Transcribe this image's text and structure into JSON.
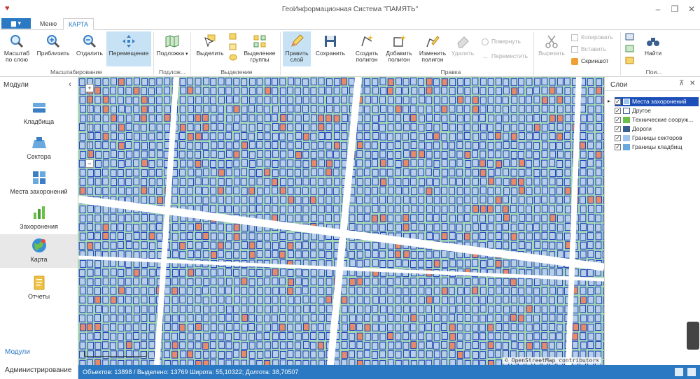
{
  "window": {
    "title": "ГеоИнформационная Система \"ПАМЯТЬ\"",
    "controls": [
      "–",
      "❐",
      "✕"
    ]
  },
  "tabs": {
    "app_button": "▆ ▾",
    "menu": "Меню",
    "map": "КАРТА"
  },
  "ribbon": {
    "fit_layer": "Масштаб\nпо слою",
    "zoom_in": "Приблизить",
    "zoom_out": "Отдалить",
    "pan": "Перемещение",
    "basemap": "Подложка",
    "select": "Выделить",
    "select_group": "Выделение\nгруппы",
    "edit_layer": "Править\nслой",
    "save": "Сохранить",
    "create_polygon": "Создать\nполигон",
    "add_polygon": "Добавить\nполигон",
    "modify_polygon": "Изменить\nполигон",
    "delete": "Удалить",
    "rotate": "Повернуть",
    "move": "Переместить",
    "cut": "Вырезать",
    "copy": "Копировать",
    "paste": "Вставить",
    "screenshot": "Скриншот",
    "find": "Найти",
    "groups": {
      "scale": "Масштабирование",
      "basemap": "Подлож...",
      "selection": "Выделение",
      "edit": "Правка",
      "search": "Пои..."
    }
  },
  "sidebar": {
    "header": "Модули",
    "items": [
      {
        "label": "Кладбища",
        "icon": "cemetery-icon"
      },
      {
        "label": "Сектора",
        "icon": "sectors-icon"
      },
      {
        "label": "Места захоронений",
        "icon": "burial-places-icon"
      },
      {
        "label": "Захоронения",
        "icon": "burials-icon"
      },
      {
        "label": "Карта",
        "icon": "globe-icon"
      },
      {
        "label": "Отчеты",
        "icon": "reports-icon"
      }
    ],
    "footer_modules": "Модули",
    "footer_admin": "Администрирование"
  },
  "map": {
    "attribution": "© OpenStreetMap contributors"
  },
  "layers_panel": {
    "title": "Слои",
    "pin": "⊼",
    "close": "✕",
    "layers": [
      {
        "name": "Места захоронений",
        "checked": true
      },
      {
        "name": "Другое",
        "checked": true
      },
      {
        "name": "Технические сооруж...",
        "checked": true
      },
      {
        "name": "Дороги",
        "checked": true
      },
      {
        "name": "Границы секторов",
        "checked": true
      },
      {
        "name": "Границы кладбищ",
        "checked": true
      }
    ]
  },
  "status": {
    "text": "Объектов: 13898 / Выделено: 13769   Широта: 55,10322; Долгота: 38,70507"
  },
  "colors": {
    "accent": "#2b79c2",
    "plot_border": "#1f3fbf",
    "plot_occupied": "#e8896a",
    "grass": "#a5d6b4",
    "road": "#ffffff"
  }
}
